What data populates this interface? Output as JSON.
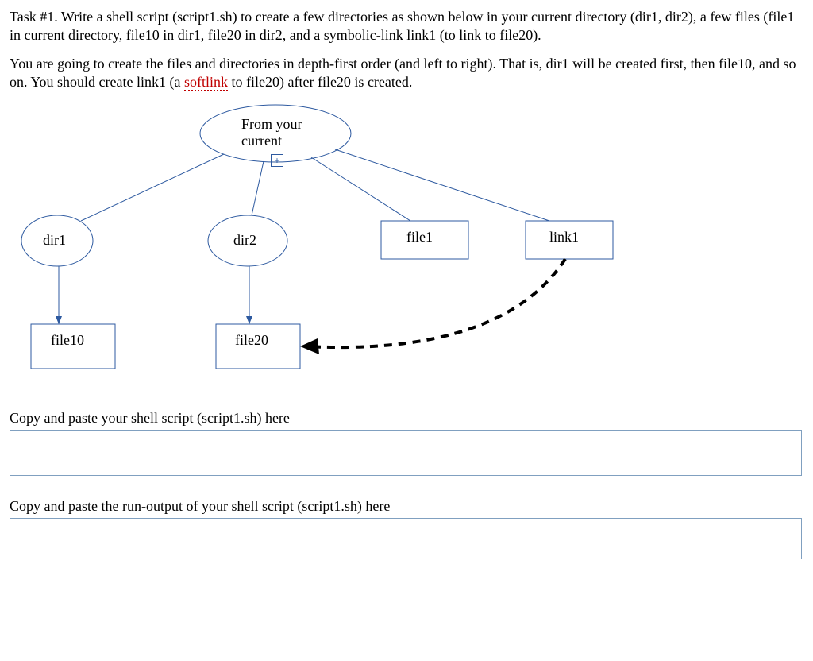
{
  "task": {
    "p1": "Task #1. Write a shell script (script1.sh) to create a few directories as shown below in your current directory (dir1, dir2), a few files (file1 in current directory, file10 in dir1, file20 in dir2, and a symbolic-link link1 (to link to file20).",
    "p2a": "You are going to create the files and directories in depth-first order (and left to right). That is, dir1 will be created first, then file10, and so on. You should create link1 (a ",
    "softlink": "softlink",
    "p2b": " to file20) after file20 is created."
  },
  "diagram": {
    "root_line1": "From your",
    "root_line2": "current",
    "dir1": "dir1",
    "dir2": "dir2",
    "file1": "file1",
    "link1": "link1",
    "file10": "file10",
    "file20": "file20"
  },
  "prompts": {
    "script": "Copy and paste your shell script (script1.sh) here",
    "output": "Copy and paste the run-output of your shell script (script1.sh) here"
  }
}
